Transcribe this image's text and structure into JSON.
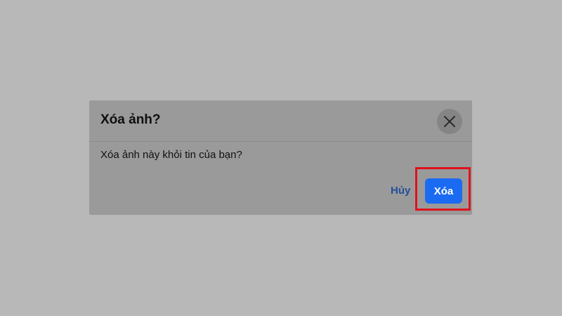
{
  "dialog": {
    "title": "Xóa ảnh?",
    "message": "Xóa ảnh này khỏi tin của bạn?",
    "cancel_label": "Hủy",
    "confirm_label": "Xóa",
    "close_icon": "close-icon"
  },
  "colors": {
    "overlay": "#b8b8b8",
    "dialog_background": "#9a9a9a",
    "confirm_button": "#1b6bf2",
    "cancel_text": "#214f9a",
    "highlight_border": "#e0121b"
  }
}
